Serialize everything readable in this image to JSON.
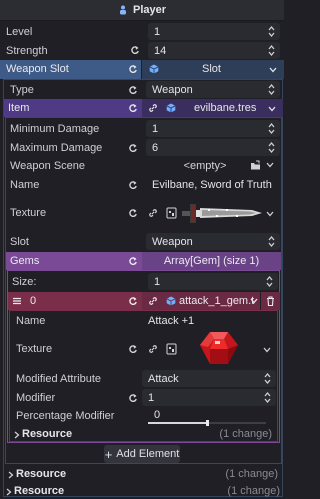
{
  "title": "Player",
  "level": {
    "label": "Level",
    "value": "1"
  },
  "strength": {
    "label": "Strength",
    "value": "14"
  },
  "weapon_slot": {
    "label": "Weapon Slot",
    "value": "Slot"
  },
  "type": {
    "label": "Type",
    "value": "Weapon"
  },
  "item": {
    "label": "Item",
    "value": "evilbane.tres"
  },
  "min_damage": {
    "label": "Minimum Damage",
    "value": "1"
  },
  "max_damage": {
    "label": "Maximum Damage",
    "value": "6"
  },
  "weapon_scene": {
    "label": "Weapon Scene",
    "value": "<empty>"
  },
  "name": {
    "label": "Name",
    "value": "Evilbane, Sword of Truth"
  },
  "texture": {
    "label": "Texture"
  },
  "slot": {
    "label": "Slot",
    "value": "Weapon"
  },
  "gems": {
    "label": "Gems",
    "value": "Array[Gem] (size 1)"
  },
  "size": {
    "label": "Size:",
    "value": "1"
  },
  "element0": {
    "index": "0",
    "value": "attack_1_gem.t"
  },
  "gem_name": {
    "label": "Name",
    "value": "Attack +1"
  },
  "gem_texture": {
    "label": "Texture"
  },
  "modified_attribute": {
    "label": "Modified Attribute",
    "value": "Attack"
  },
  "modifier": {
    "label": "Modifier",
    "value": "1"
  },
  "percentage_modifier": {
    "label": "Percentage Modifier",
    "value": "0",
    "level": 0.0
  },
  "inner_resource": {
    "label": "Resource",
    "changes": "(1 change)"
  },
  "add_element": "Add Element",
  "resource1": {
    "label": "Resource",
    "changes": "(1 change)"
  },
  "resource2": {
    "label": "Resource",
    "changes": "(1 change)"
  },
  "colors": {
    "blue_header": "#3e5a86",
    "purple_header": "#4f3a85",
    "violet_header": "#7a4a96",
    "pink_header": "#7a2e4a"
  }
}
